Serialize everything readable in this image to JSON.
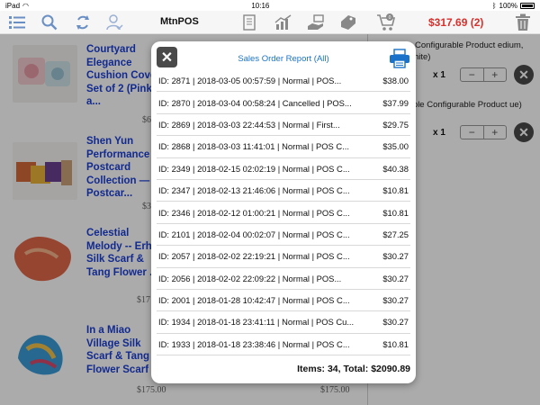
{
  "status": {
    "device": "iPad",
    "time": "10:16",
    "battery": "100%"
  },
  "app": {
    "title": "MtnPOS",
    "cart_total": "$317.69 (2)"
  },
  "toolbar_icons": [
    "menu-icon",
    "search-icon",
    "sync-icon",
    "user-icon",
    "receipt-icon",
    "chart-icon",
    "cash-hand-icon",
    "coupon-icon",
    "cart-icon",
    "trash-icon"
  ],
  "products": [
    {
      "name": "Courtyard Elegance Cushion Cover Set of 2 (Pink) a...",
      "price": "$6",
      "price_right": ""
    },
    {
      "name": "Shen Yun Performance Postcard Collection — Postcar...",
      "price": "$3",
      "price_right": ""
    },
    {
      "name": "Celestial Melody -- Erhu Silk Scarf & Tang Flower ...",
      "price": "$17",
      "price_right": ""
    },
    {
      "name": " In a Miao Village Silk Scarf & Tang Flower Scarf ...",
      "price": "$175.00",
      "price_right": "$175.00"
    }
  ],
  "cart": {
    "items": [
      {
        "name": "st Configurable Product edium, White)",
        "qty": "x 1"
      },
      {
        "name": "mple Configurable Product ue)",
        "qty": "x 1"
      }
    ]
  },
  "modal": {
    "title": "Sales Order Report (All)",
    "rows": [
      {
        "text": "ID: 2871 | 2018-03-05 00:57:59 | Normal | POS...",
        "amount": "$38.00"
      },
      {
        "text": "ID: 2870 | 2018-03-04 00:58:24 | Cancelled | POS...",
        "amount": "$37.99"
      },
      {
        "text": "ID: 2869 | 2018-03-03 22:44:53 | Normal | First...",
        "amount": "$29.75"
      },
      {
        "text": "ID: 2868 | 2018-03-03 11:41:01 | Normal | POS C...",
        "amount": "$35.00"
      },
      {
        "text": "ID: 2349 | 2018-02-15 02:02:19 | Normal | POS C...",
        "amount": "$40.38"
      },
      {
        "text": "ID: 2347 | 2018-02-13 21:46:06 | Normal | POS C...",
        "amount": "$10.81"
      },
      {
        "text": "ID: 2346 | 2018-02-12 01:00:21 | Normal | POS C...",
        "amount": "$10.81"
      },
      {
        "text": "ID: 2101 | 2018-02-04 00:02:07 | Normal | POS C...",
        "amount": "$27.25"
      },
      {
        "text": "ID: 2057 | 2018-02-02 22:19:21 | Normal | POS C...",
        "amount": "$30.27"
      },
      {
        "text": "ID: 2056 | 2018-02-02 22:09:22 | Normal | POS...",
        "amount": "$30.27"
      },
      {
        "text": "ID: 2001 | 2018-01-28 10:42:47 | Normal | POS C...",
        "amount": "$30.27"
      },
      {
        "text": "ID: 1934 | 2018-01-18 23:41:11 | Normal | POS Cu...",
        "amount": "$30.27"
      },
      {
        "text": "ID: 1933 | 2018-01-18 23:38:46 | Normal | POS C...",
        "amount": "$10.81"
      }
    ],
    "footer": "Items: 34, Total: $2090.89"
  },
  "colors": {
    "accent": "#1a73c8",
    "total_red": "#d9302c",
    "link_blue": "#1c3fd6"
  }
}
